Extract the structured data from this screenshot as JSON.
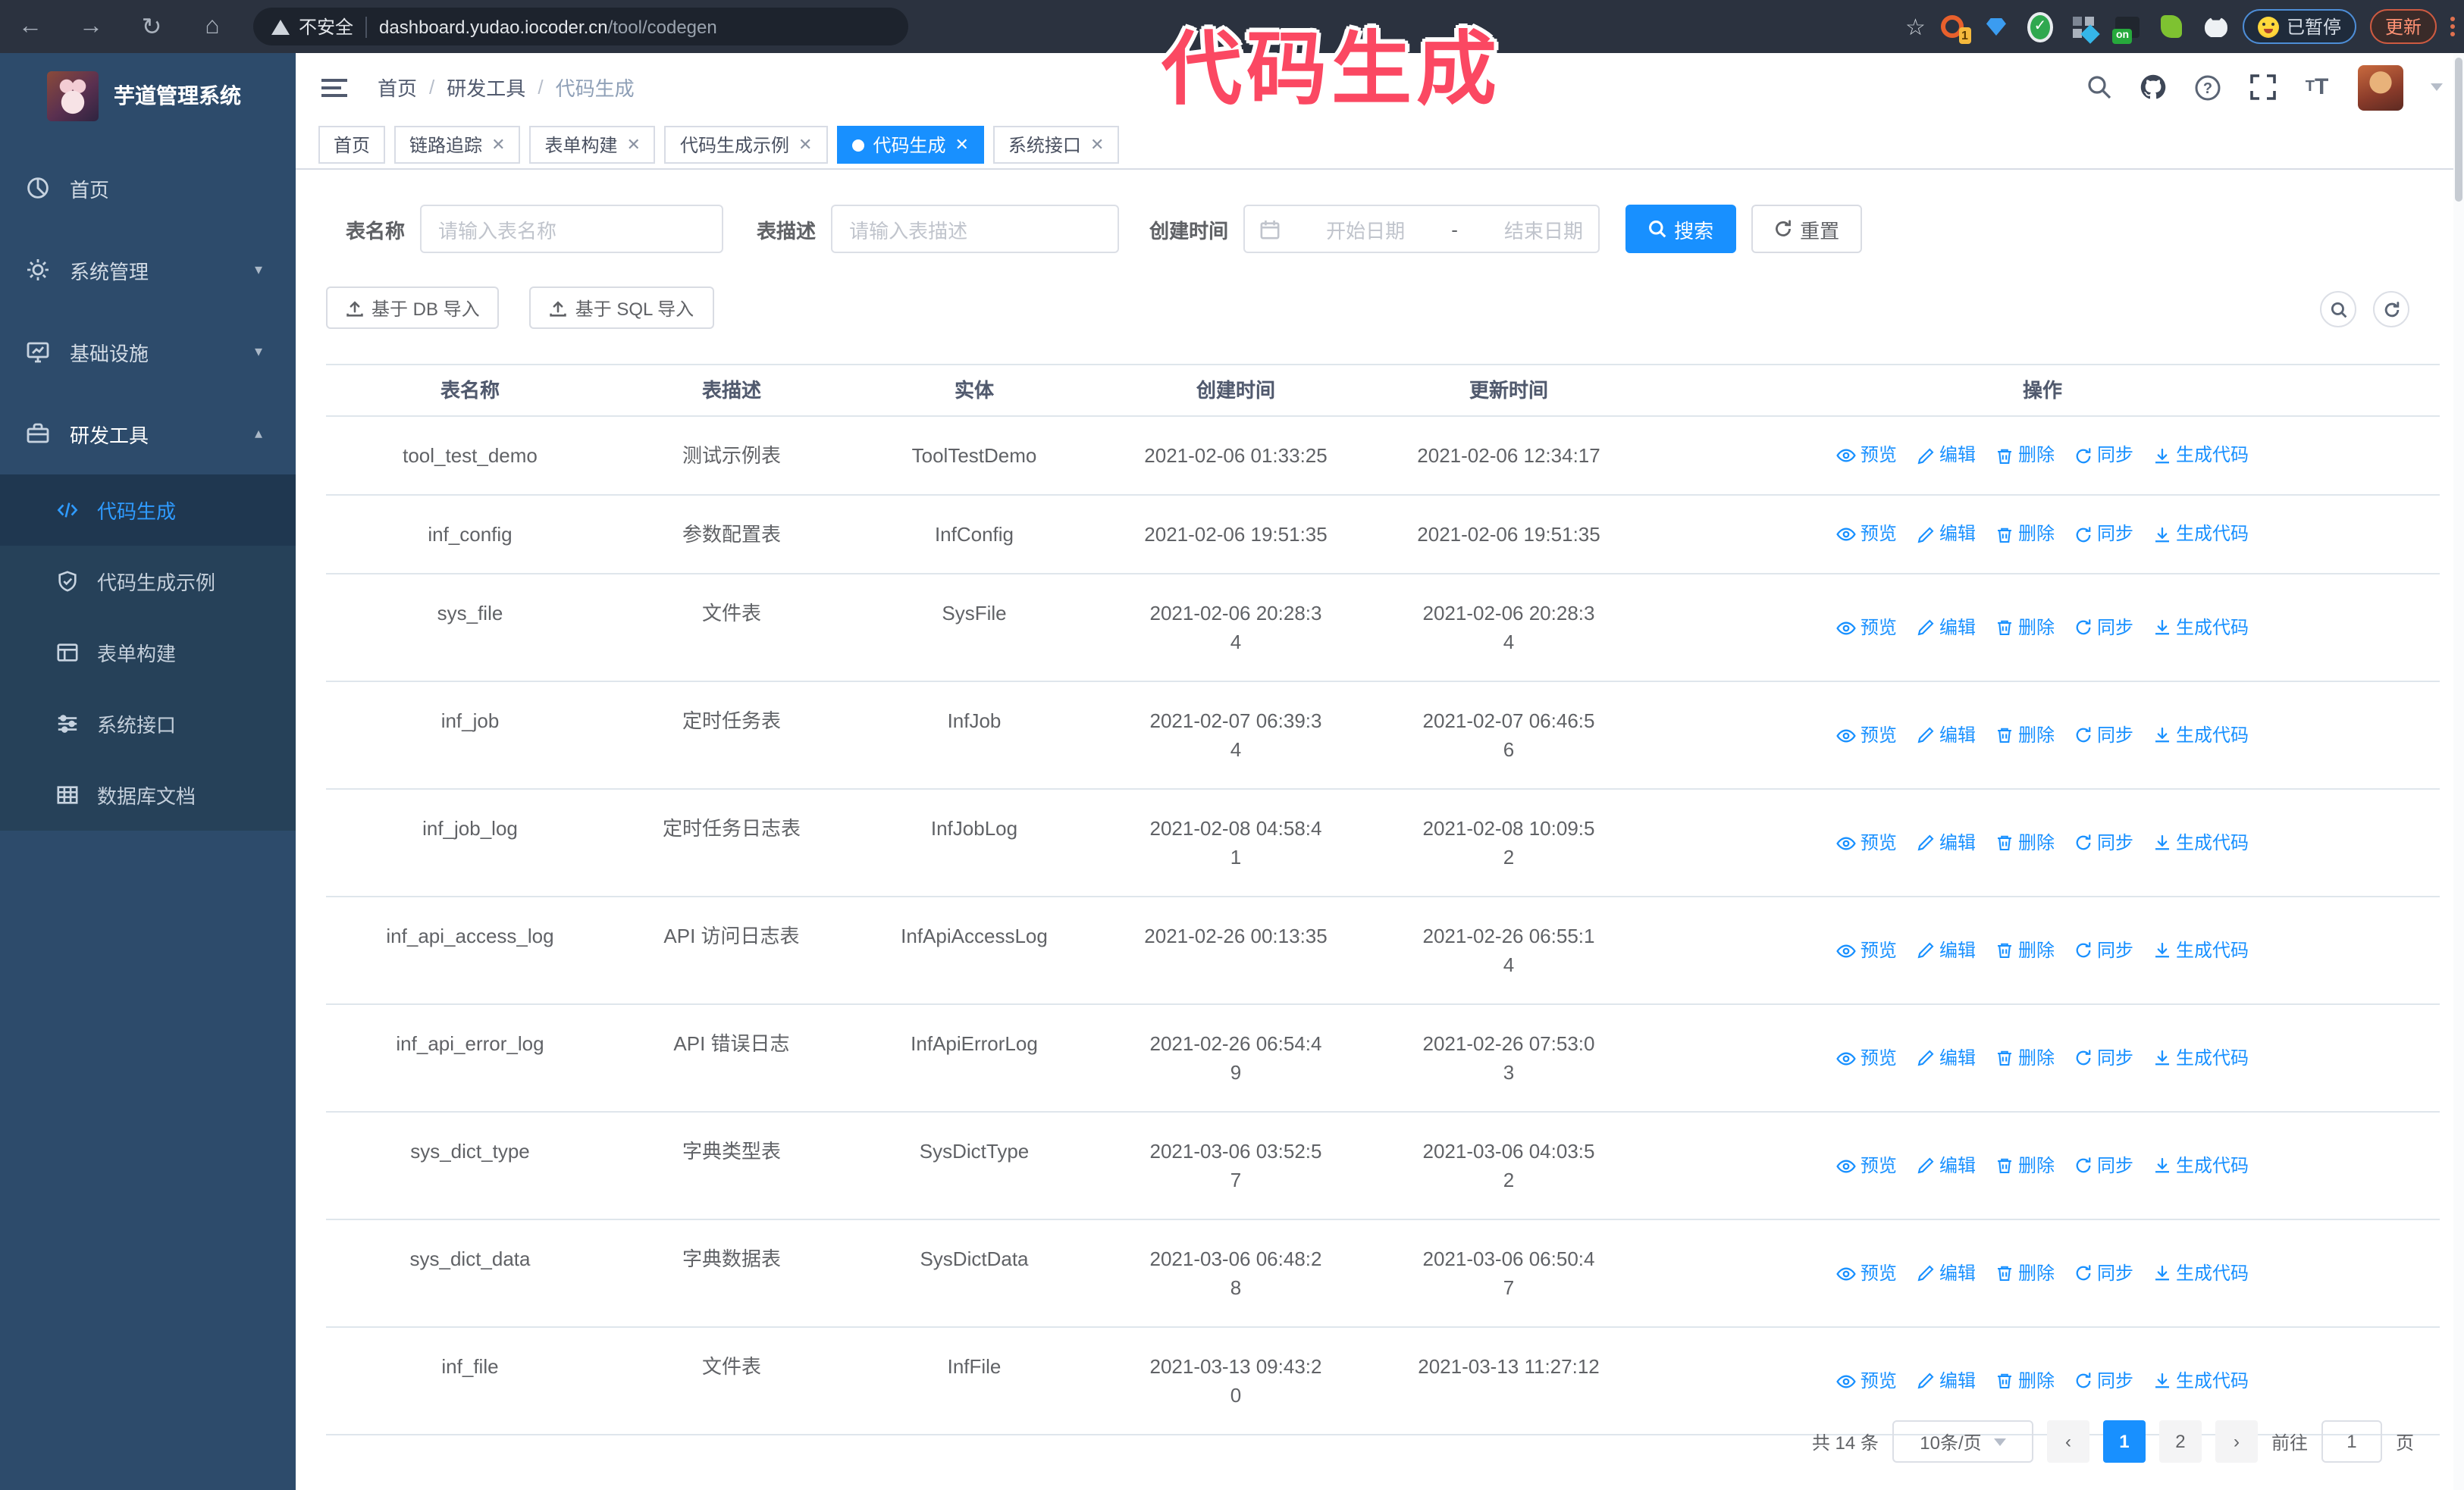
{
  "annotation": {
    "text": "代码生成",
    "color": "#fb4862"
  },
  "browser": {
    "insecure_label": "不安全",
    "url_host": "dashboard.yudao.iocoder.cn",
    "url_path": "/tool/codegen",
    "extensions": [
      {
        "name": "orange-extension",
        "badge": "1"
      },
      {
        "name": "blue-gem-extension",
        "badge": ""
      },
      {
        "name": "green-check-extension",
        "badge": ""
      },
      {
        "name": "grid-diamond-extension",
        "badge": ""
      },
      {
        "name": "dark-extension",
        "badge": "on"
      },
      {
        "name": "green-plugin-extension",
        "badge": ""
      },
      {
        "name": "white-pet-extension",
        "badge": ""
      }
    ],
    "paused_badge": "已暂停",
    "update_button": "更新"
  },
  "sidebar": {
    "logo_title": "芋道管理系统",
    "items": [
      {
        "label": "首页",
        "icon": "dashboard",
        "chevron": "",
        "active": false
      },
      {
        "label": "系统管理",
        "icon": "gear",
        "chevron": "down",
        "active": false
      },
      {
        "label": "基础设施",
        "icon": "monitor",
        "chevron": "down",
        "active": false
      },
      {
        "label": "研发工具",
        "icon": "toolbox",
        "chevron": "up",
        "active": true
      }
    ],
    "submenu": [
      {
        "label": "代码生成",
        "icon": "code",
        "active": true
      },
      {
        "label": "代码生成示例",
        "icon": "shield",
        "active": false
      },
      {
        "label": "表单构建",
        "icon": "form",
        "active": false
      },
      {
        "label": "系统接口",
        "icon": "sliders",
        "active": false
      },
      {
        "label": "数据库文档",
        "icon": "dbdoc",
        "active": false
      }
    ]
  },
  "header": {
    "breadcrumb": [
      "首页",
      "研发工具",
      "代码生成"
    ]
  },
  "tabs": [
    {
      "label": "首页",
      "closable": false,
      "active": false
    },
    {
      "label": "链路追踪",
      "closable": true,
      "active": false
    },
    {
      "label": "表单构建",
      "closable": true,
      "active": false
    },
    {
      "label": "代码生成示例",
      "closable": true,
      "active": false
    },
    {
      "label": "代码生成",
      "closable": true,
      "active": true
    },
    {
      "label": "系统接口",
      "closable": true,
      "active": false
    }
  ],
  "search": {
    "name_label": "表名称",
    "name_placeholder": "请输入表名称",
    "desc_label": "表描述",
    "desc_placeholder": "请输入表描述",
    "time_label": "创建时间",
    "start_placeholder": "开始日期",
    "range_separator": "-",
    "end_placeholder": "结束日期",
    "search_button": "搜索",
    "reset_button": "重置"
  },
  "toolbar": {
    "db_import_button": "基于 DB 导入",
    "sql_import_button": "基于 SQL 导入"
  },
  "table": {
    "columns": [
      "表名称",
      "表描述",
      "实体",
      "创建时间",
      "更新时间",
      "操作"
    ],
    "action_labels": [
      "预览",
      "编辑",
      "删除",
      "同步",
      "生成代码"
    ],
    "rows": [
      {
        "name": "tool_test_demo",
        "desc": "测试示例表",
        "entity": "ToolTestDemo",
        "created": "2021-02-06 01:33:25",
        "updated": "2021-02-06 12:34:17"
      },
      {
        "name": "inf_config",
        "desc": "参数配置表",
        "entity": "InfConfig",
        "created": "2021-02-06 19:51:35",
        "updated": "2021-02-06 19:51:35"
      },
      {
        "name": "sys_file",
        "desc": "文件表",
        "entity": "SysFile",
        "created": "2021-02-06 20:28:3\n4",
        "updated": "2021-02-06 20:28:3\n4"
      },
      {
        "name": "inf_job",
        "desc": "定时任务表",
        "entity": "InfJob",
        "created": "2021-02-07 06:39:3\n4",
        "updated": "2021-02-07 06:46:5\n6"
      },
      {
        "name": "inf_job_log",
        "desc": "定时任务日志表",
        "entity": "InfJobLog",
        "created": "2021-02-08 04:58:4\n1",
        "updated": "2021-02-08 10:09:5\n2"
      },
      {
        "name": "inf_api_access_log",
        "desc": "API 访问日志表",
        "entity": "InfApiAccessLog",
        "created": "2021-02-26 00:13:35",
        "updated": "2021-02-26 06:55:1\n4"
      },
      {
        "name": "inf_api_error_log",
        "desc": "API 错误日志",
        "entity": "InfApiErrorLog",
        "created": "2021-02-26 06:54:4\n9",
        "updated": "2021-02-26 07:53:0\n3"
      },
      {
        "name": "sys_dict_type",
        "desc": "字典类型表",
        "entity": "SysDictType",
        "created": "2021-03-06 03:52:5\n7",
        "updated": "2021-03-06 04:03:5\n2"
      },
      {
        "name": "sys_dict_data",
        "desc": "字典数据表",
        "entity": "SysDictData",
        "created": "2021-03-06 06:48:2\n8",
        "updated": "2021-03-06 06:50:4\n7"
      },
      {
        "name": "inf_file",
        "desc": "文件表",
        "entity": "InfFile",
        "created": "2021-03-13 09:43:2\n0",
        "updated": "2021-03-13 11:27:12"
      }
    ]
  },
  "pagination": {
    "total": "共 14 条",
    "page_size": "10条/页",
    "pages": [
      "1",
      "2"
    ],
    "active_page": "1",
    "goto_label": "前往",
    "goto_value": "1",
    "page_label": "页"
  },
  "colors": {
    "primary": "#1890ff",
    "sidebar_bg": "#2d4b6b",
    "submenu_bg": "#264159",
    "chrome_bg": "#2b323f",
    "annotation": "#fb4862",
    "table_border": "#dfe6ec"
  }
}
